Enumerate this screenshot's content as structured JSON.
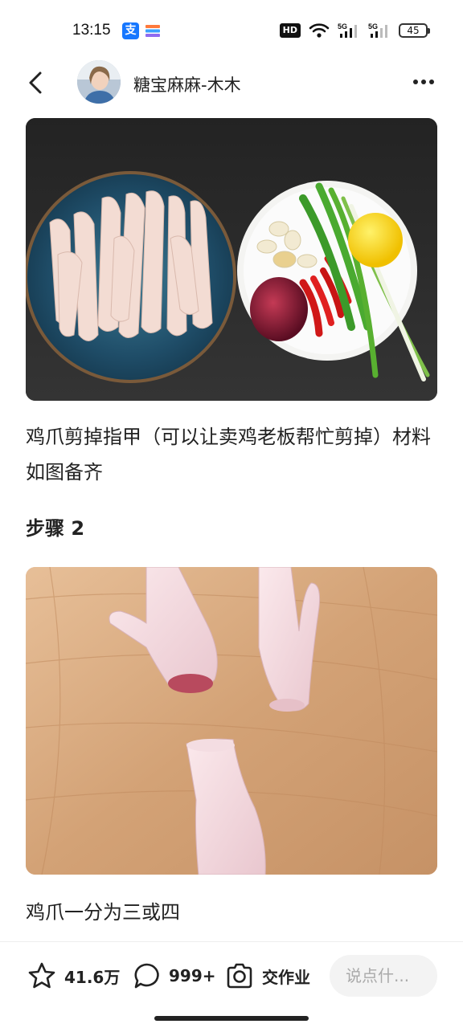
{
  "status_bar": {
    "time": "13:15",
    "alipay_icon_text": "支",
    "hd_label": "HD",
    "network_1": "5G",
    "network_2": "5G",
    "battery": "45"
  },
  "header": {
    "author_name": "糖宝麻麻-木木"
  },
  "content": {
    "photo1_alt": "鸡爪与配料",
    "caption1": "鸡爪剪掉指甲（可以让卖鸡老板帮忙剪掉）材料如图备齐",
    "step_title": "步骤 2",
    "photo2_alt": "鸡爪切块",
    "caption2": "鸡爪一分为三或四"
  },
  "bottom_bar": {
    "favorite_count": "41.6万",
    "comment_count": "999+",
    "homework_label": "交作业",
    "comment_placeholder": "说点什..."
  },
  "icons": {
    "back": "chevron-left-icon",
    "more": "more-dots-icon",
    "favorite": "star-icon",
    "comment": "chat-bubble-icon",
    "homework": "camera-icon",
    "wifi": "wifi-icon",
    "signal": "signal-icon"
  }
}
